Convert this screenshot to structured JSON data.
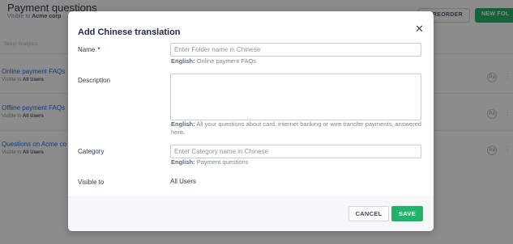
{
  "background": {
    "title": "Payment questions",
    "subtitle_prefix": "Visible to",
    "subtitle_value": "Acme corp",
    "reorder_label": "REORDER",
    "new_label": "NEW FOL",
    "tabs": "Setup   Analytics",
    "rows": [
      {
        "title": "Online payment FAQs",
        "visible_prefix": "Visible to",
        "visible_value": "All Users"
      },
      {
        "title": "Offline payment FAQs",
        "visible_prefix": "Visible to",
        "visible_value": "All Users"
      },
      {
        "title": "Questions on Acme co",
        "visible_prefix": "Visible to",
        "visible_value": "All Users"
      }
    ],
    "row_icon": "Pa"
  },
  "modal": {
    "title": "Add Chinese translation",
    "close_icon": "close-icon",
    "name": {
      "label": "Name",
      "required_mark": "*",
      "placeholder": "Enter Folder name in Chinese",
      "hint_label": "English:",
      "hint_value": "Online payment FAQs"
    },
    "description": {
      "label": "Description",
      "hint_label": "English:",
      "hint_value": "All your questions about card, internet banking or wire transfer payments, answered here."
    },
    "category": {
      "label": "Category",
      "placeholder": "Enter Category name in Chinese",
      "hint_label": "English:",
      "hint_value": "Payment questions"
    },
    "visible_to": {
      "label": "Visible to",
      "value": "All Users"
    },
    "cancel_label": "CANCEL",
    "save_label": "SAVE"
  },
  "colors": {
    "primary_green": "#20b36a",
    "link_blue": "#1b6ef3",
    "required_red": "#e02b27"
  }
}
